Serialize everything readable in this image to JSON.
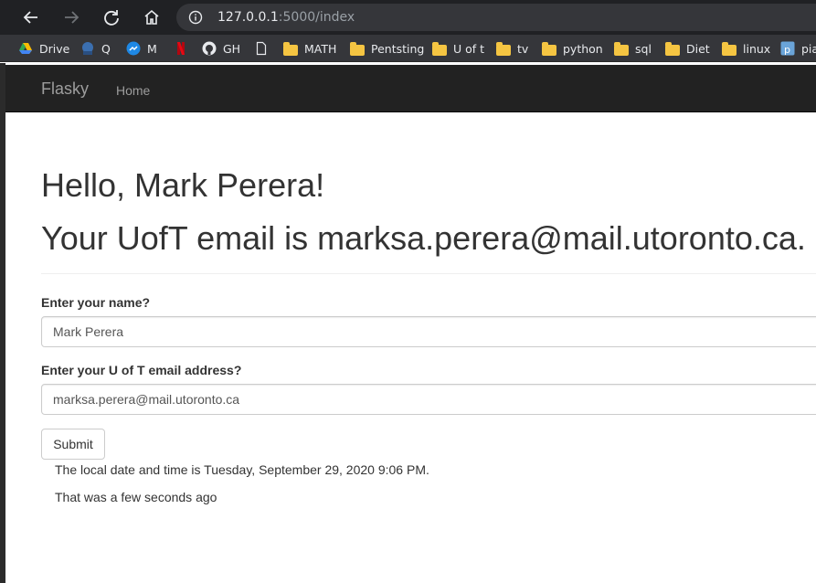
{
  "browser": {
    "url_host": "127.0.0.1",
    "url_rest": ":5000/index",
    "bookmarks": [
      {
        "label": "Drive",
        "icon": "google-drive-icon"
      },
      {
        "label": "Q",
        "icon": "q-icon"
      },
      {
        "label": "M",
        "icon": "messenger-icon"
      },
      {
        "label": "",
        "icon": "netflix-icon"
      },
      {
        "label": "GH",
        "icon": "github-icon"
      },
      {
        "label": "",
        "icon": "page-icon"
      },
      {
        "label": "MATH",
        "icon": "folder-icon"
      },
      {
        "label": "Pentsting",
        "icon": "folder-icon"
      },
      {
        "label": "U of t",
        "icon": "folder-icon"
      },
      {
        "label": "tv",
        "icon": "folder-icon"
      },
      {
        "label": "python",
        "icon": "folder-icon"
      },
      {
        "label": "sql",
        "icon": "folder-icon"
      },
      {
        "label": "Diet",
        "icon": "folder-icon"
      },
      {
        "label": "linux",
        "icon": "folder-icon"
      },
      {
        "label": "pia",
        "icon": "pia-icon"
      }
    ]
  },
  "navbar": {
    "brand": "Flasky",
    "home": "Home"
  },
  "page": {
    "greeting": "Hello, Mark Perera!",
    "email_line": "Your UofT email is marksa.perera@mail.utoronto.ca.",
    "name_label": "Enter your name?",
    "name_value": "Mark Perera",
    "email_label": "Enter your U of T email address?",
    "email_value": "marksa.perera@mail.utoronto.ca",
    "submit_label": "Submit",
    "local_time": "The local date and time is Tuesday, September 29, 2020 9:06 PM.",
    "relative_time": "That was a few seconds ago"
  },
  "colors": {
    "navbar_bg": "#222222",
    "browser_bg": "#202124"
  }
}
